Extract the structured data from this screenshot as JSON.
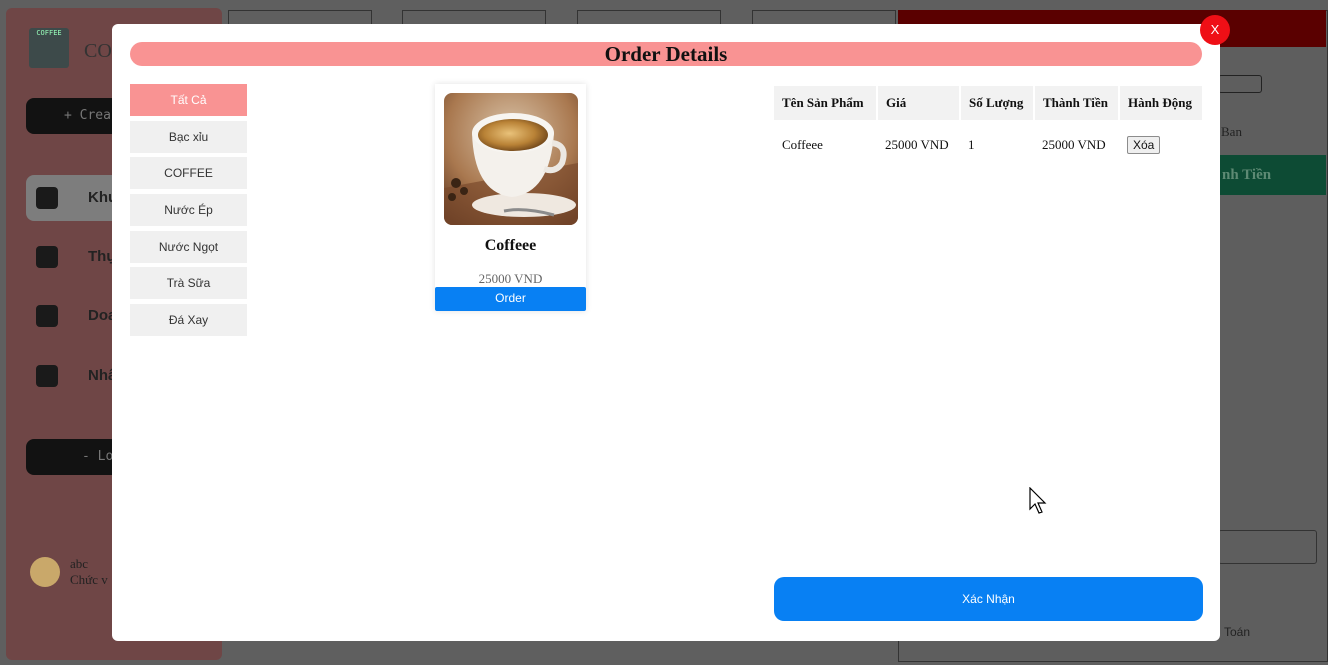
{
  "background": {
    "brand": "CO",
    "logo_text": "COFFEE",
    "create_label": "+ Crea",
    "nav": [
      {
        "label": "Khu",
        "icon": "table-icon"
      },
      {
        "label": "Thự",
        "icon": "menu-book-icon"
      },
      {
        "label": "Doa",
        "icon": "revenue-icon"
      },
      {
        "label": "Nhâ",
        "icon": "staff-card-icon"
      }
    ],
    "logout_label": "- Lo",
    "user_name": "abc",
    "user_role": "Chức v",
    "right_label_ban": "Ban",
    "right_header_tien": "nh Tiền",
    "right_footer": "Toán"
  },
  "modal": {
    "title": "Order Details",
    "close_label": "X",
    "categories": [
      "Tất Cả",
      "Bạc xỉu",
      "COFFEE",
      "Nước Ép",
      "Nước Ngọt",
      "Trà Sữa",
      "Đá Xay"
    ],
    "active_category": 0,
    "products": [
      {
        "name": "Coffeee",
        "price": "25000 VND",
        "order_label": "Order"
      }
    ],
    "table": {
      "headers": [
        "Tên Sản Phẩm",
        "Giá",
        "Số Lượng",
        "Thành Tiền",
        "Hành Động"
      ],
      "rows": [
        {
          "name": "Coffeee",
          "price": "25000 VND",
          "qty": "1",
          "total": "25000 VND",
          "action": "Xóa"
        }
      ]
    },
    "confirm_label": "Xác Nhận"
  },
  "colors": {
    "title_bar": "#f99393",
    "primary": "#0880f3",
    "close": "#ef0f16"
  }
}
